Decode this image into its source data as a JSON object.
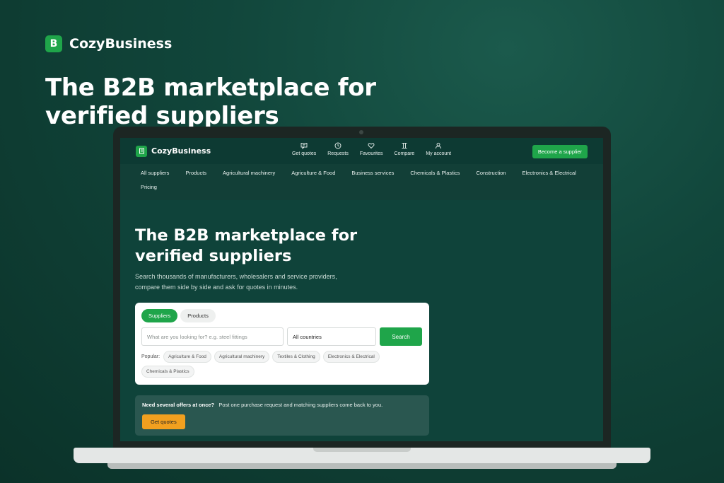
{
  "outer": {
    "logo_letter": "B",
    "brand_name": "CozyBusiness",
    "headline": "The B2B marketplace for verified suppliers"
  },
  "header": {
    "brand_name": "CozyBusiness",
    "nav": [
      {
        "label": "Get quotes",
        "icon": "chat-icon"
      },
      {
        "label": "Requests",
        "icon": "clock-icon"
      },
      {
        "label": "Favourites",
        "icon": "heart-icon"
      },
      {
        "label": "Compare",
        "icon": "compare-icon"
      },
      {
        "label": "My account",
        "icon": "user-icon"
      }
    ],
    "cta_label": "Become a supplier"
  },
  "categories": [
    "All suppliers",
    "Products",
    "Agricultural machinery",
    "Agriculture & Food",
    "Business services",
    "Chemicals & Plastics",
    "Construction",
    "Electronics & Electrical",
    "Pricing"
  ],
  "hero": {
    "title": "The B2B marketplace for verified suppliers",
    "subtitle": "Search thousands of manufacturers, wholesalers and service providers, compare them side by side and ask for quotes in minutes."
  },
  "search": {
    "tabs": [
      "Suppliers",
      "Products"
    ],
    "active_tab": "Suppliers",
    "placeholder": "What are you looking for? e.g. steel fittings",
    "country": "All countries",
    "button_label": "Search",
    "popular_label": "Popular:",
    "popular": [
      "Agriculture & Food",
      "Agricultural machinery",
      "Textiles & Clothing",
      "Electronics & Electrical",
      "Chemicals & Plastics"
    ]
  },
  "offer": {
    "bold_text": "Need several offers at once?",
    "text": "Post one purchase request and matching suppliers come back to you.",
    "button_label": "Get quotes"
  },
  "colors": {
    "brand_green": "#1fa54a",
    "accent_orange": "#f2a01f",
    "background": "#0f433a"
  }
}
